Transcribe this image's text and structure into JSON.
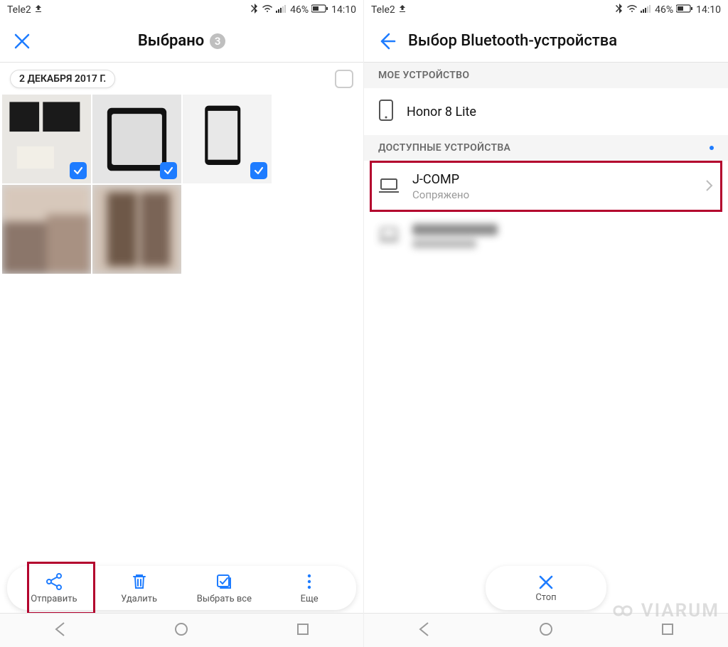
{
  "status": {
    "carrier": "Tele2",
    "battery_pct": "46%",
    "time": "14:10"
  },
  "left": {
    "title": "Выбрано",
    "selected_count": "3",
    "date_header": "2 ДЕКАБРЯ 2017 Г.",
    "actions": {
      "send": "Отправить",
      "delete": "Удалить",
      "select_all": "Выбрать все",
      "more": "Еще"
    }
  },
  "right": {
    "title": "Выбор Bluetooth-устройства",
    "my_device_header": "МОЕ УСТРОЙСТВО",
    "my_device_name": "Honor 8 Lite",
    "available_header": "ДОСТУПНЫЕ УСТРОЙСТВА",
    "device1_name": "J-COMP",
    "device1_status": "Сопряжено",
    "stop_label": "Стоп"
  },
  "watermark": "VIARUM"
}
